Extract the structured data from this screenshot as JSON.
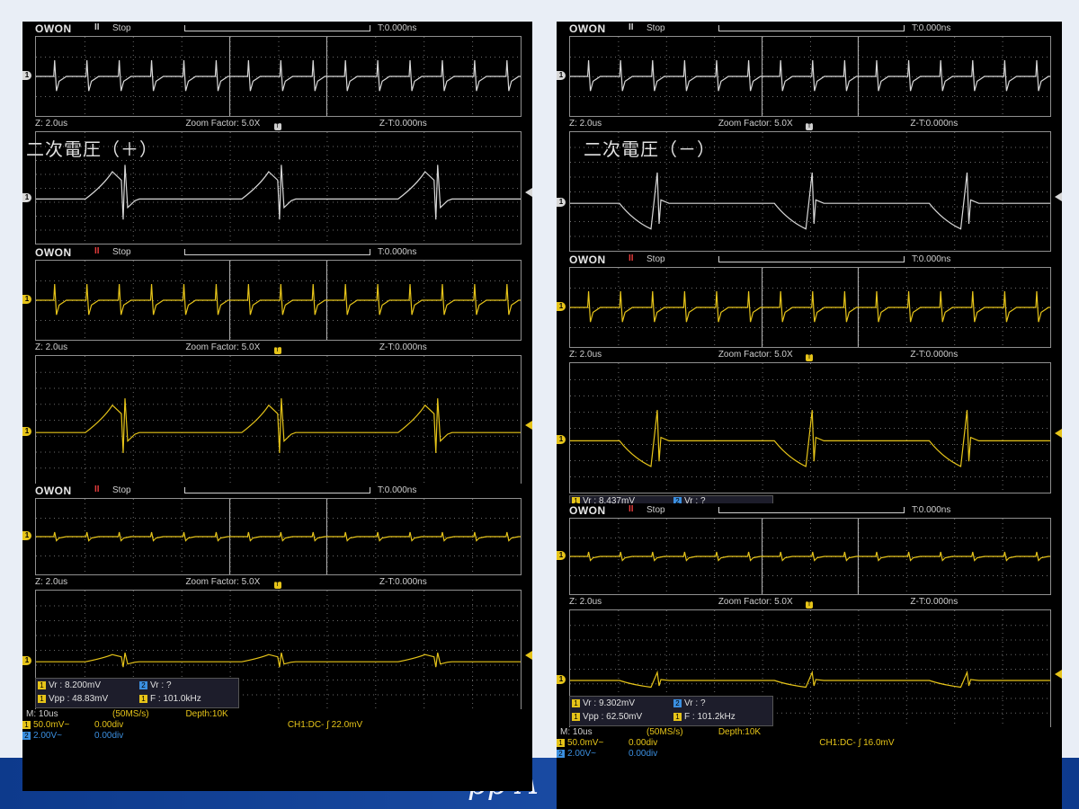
{
  "colors": {
    "white_trace": "#d8d8d8",
    "yellow_trace": "#e6c419",
    "ch2": "#3b8fe0",
    "run_red": "#e23b3b"
  },
  "common": {
    "logo": "OWON",
    "stop": "Stop",
    "tval": "T:0.000ns",
    "zoom": "Z: 2.0us",
    "zoomfactor": "Zoom Factor: 5.0X",
    "zt": "Z-T:0.000ns",
    "run_white": "II",
    "run_red": "II"
  },
  "left": {
    "label": "二次電圧（＋）",
    "meas": {
      "vr1": "Vr : 8.200mV",
      "vr2": "Vr :    ?",
      "vpp": "Vpp : 48.83mV",
      "f": "F : 101.0kHz"
    },
    "bottom": {
      "m": "M: 10us",
      "sr": "(50MS/s)",
      "depth": "Depth:10K",
      "ch1": "50.0mV~",
      "ch1off": "0.00div",
      "ch2": "2.00V~",
      "ch2off": "0.00div",
      "trig": "CH1:DC- ∫ 22.0mV"
    }
  },
  "right": {
    "label": "二次電圧（－）",
    "meas_partial": {
      "vr1": "Vr : 8.437mV",
      "vr2": "Vr :    ?"
    },
    "meas": {
      "vr1": "Vr : 9.302mV",
      "vr2": "Vr :    ?",
      "vpp": "Vpp : 62.50mV",
      "f": "F : 101.2kHz"
    },
    "bottom": {
      "m": "M: 10us",
      "sr": "(50MS/s)",
      "depth": "Depth:10K",
      "ch1": "50.0mV~",
      "ch1off": "0.00div",
      "ch2": "2.00V~",
      "ch2off": "0.00div",
      "trig": "CH1:DC- ∫ 16.0mV"
    }
  },
  "band_text": "pp A"
}
